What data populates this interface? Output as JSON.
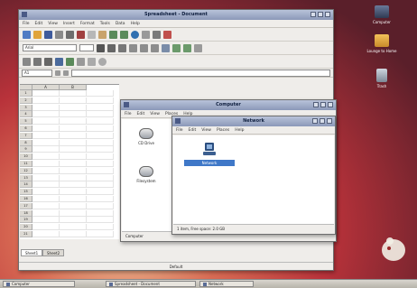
{
  "desktop": {
    "icons": [
      {
        "label": "Computer"
      },
      {
        "label": "Lounge to Home"
      },
      {
        "label": "Trash"
      }
    ]
  },
  "spreadsheet": {
    "title": "Spreadsheet - Document",
    "menu": [
      "File",
      "Edit",
      "View",
      "Insert",
      "Format",
      "Tools",
      "Data",
      "Help"
    ],
    "font_value": "Arial",
    "cell_ref": "A1",
    "columns": [
      "A",
      "B"
    ],
    "rows": [
      "1",
      "2",
      "3",
      "4",
      "5",
      "6",
      "7",
      "8",
      "9",
      "10",
      "11",
      "12",
      "13",
      "14",
      "15",
      "16",
      "17",
      "18",
      "19",
      "20",
      "21"
    ],
    "sheet_tabs": [
      "Sheet1",
      "Sheet2"
    ],
    "status": "Default"
  },
  "computer": {
    "title": "Computer",
    "menu": [
      "File",
      "Edit",
      "View",
      "Places",
      "Help"
    ],
    "items": [
      {
        "label": "CD Drive"
      },
      {
        "label": "Filesystem"
      }
    ],
    "location": "Computer"
  },
  "network": {
    "title": "Network",
    "menu": [
      "File",
      "Edit",
      "View",
      "Places",
      "Help"
    ],
    "item": "Network",
    "status": "1 item, Free space: 2.0 GB"
  },
  "taskbar": {
    "tasks": [
      "Computer",
      "Spreadsheet - Document",
      "Network"
    ]
  }
}
